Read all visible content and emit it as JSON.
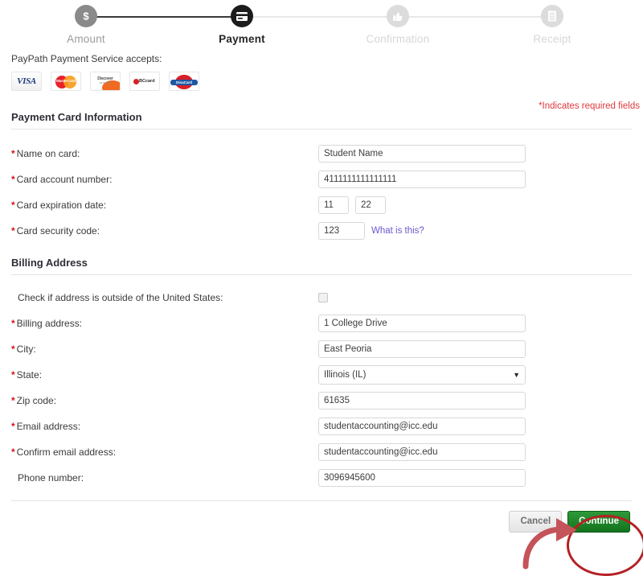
{
  "stepper": {
    "steps": [
      {
        "label": "Amount",
        "icon": "dollar-circle-icon",
        "state": "done"
      },
      {
        "label": "Payment",
        "icon": "credit-card-icon",
        "state": "current"
      },
      {
        "label": "Confirmation",
        "icon": "thumbs-up-icon",
        "state": "todo"
      },
      {
        "label": "Receipt",
        "icon": "receipt-lines-icon",
        "state": "todo"
      }
    ]
  },
  "accepts": {
    "label": "PayPath Payment Service accepts:",
    "cards": [
      {
        "name": "visa-logo",
        "text": "VISA"
      },
      {
        "name": "mastercard-logo",
        "text": "MasterCard"
      },
      {
        "name": "discover-logo",
        "text": "Discover",
        "sub": "NETWORK"
      },
      {
        "name": "bccard-logo",
        "text": "BCcard"
      },
      {
        "name": "dinacard-logo",
        "text": "DinaCard"
      }
    ]
  },
  "required_note": "*Indicates required fields",
  "sections": {
    "payment_card": {
      "title": "Payment Card Information",
      "fields": {
        "name_on_card": {
          "label": "Name on card:",
          "value": "Student Name",
          "required": true
        },
        "card_account_number": {
          "label": "Card account number:",
          "value": "4111111111111111",
          "required": true
        },
        "card_expiration_date": {
          "label": "Card expiration date:",
          "month": "11",
          "year": "22",
          "required": true
        },
        "card_security_code": {
          "label": "Card security code:",
          "value": "123",
          "help_link": "What is this?",
          "required": true
        }
      }
    },
    "billing_address": {
      "title": "Billing Address",
      "fields": {
        "outside_us": {
          "label": "Check if address is outside of the United States:",
          "checked": false,
          "required": false
        },
        "billing_address": {
          "label": "Billing address:",
          "value": "1 College Drive",
          "required": true
        },
        "city": {
          "label": "City:",
          "value": "East Peoria",
          "required": true
        },
        "state": {
          "label": "State:",
          "value": "Illinois (IL)",
          "options": [
            "Illinois (IL)"
          ],
          "caret": "▼",
          "required": true
        },
        "zip_code": {
          "label": "Zip code:",
          "value": "61635",
          "required": true
        },
        "email_address": {
          "label": "Email address:",
          "value": "studentaccounting@icc.edu",
          "required": true
        },
        "confirm_email_address": {
          "label": "Confirm email address:",
          "value": "studentaccounting@icc.edu",
          "required": true
        },
        "phone_number": {
          "label": "Phone number:",
          "value": "3096945600",
          "required": false
        }
      }
    }
  },
  "actions": {
    "cancel_label": "Cancel",
    "continue_label": "Continue"
  },
  "colors": {
    "required_red": "#d4121b",
    "continue_green": "#12731d",
    "annotation_red": "#b52024",
    "link_purple": "#6a5acd",
    "current_step": "#1c1c1c"
  },
  "annotations": {
    "highlight_target": "continue-button",
    "ellipse": "red-ellipse-around-continue",
    "arrow": "red-arrow-pointing-to-continue"
  }
}
